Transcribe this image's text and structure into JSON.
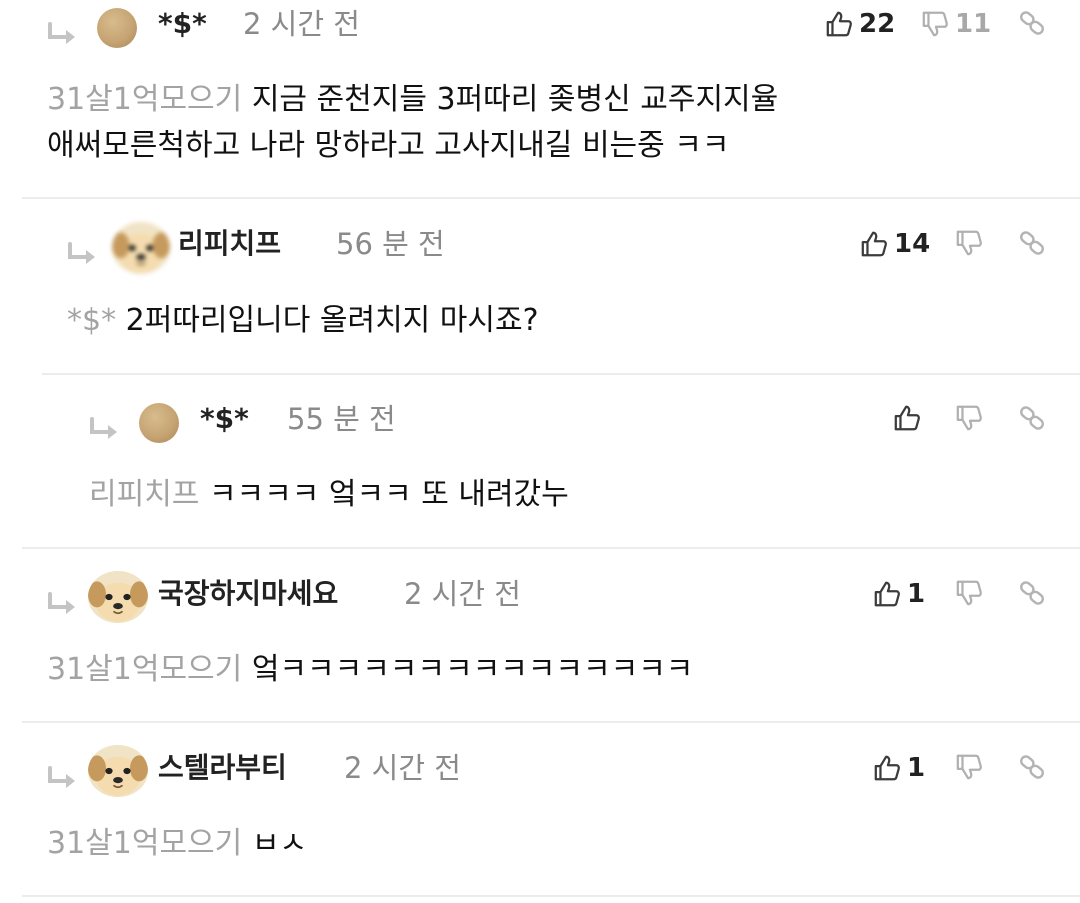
{
  "comments": [
    {
      "author": "*$*",
      "time": "2 시간 전",
      "likes": "22",
      "dislikes": "11",
      "mention": "31살1억모으기",
      "text_line1": "지금 준천지들 3퍼따리 좆병신 교주지지율",
      "text_line2": "애써모른척하고 나라 망하라고 고사지내길 비는중 ㅋㅋ",
      "avatar_icon": "tan-circle-avatar"
    },
    {
      "author": "리피치프",
      "time": "56 분 전",
      "likes": "14",
      "mention": "*$*",
      "text": "2퍼따리입니다 올려치지 마시죠?",
      "avatar_icon": "blurred-puppy-avatar"
    },
    {
      "author": "*$*",
      "time": "55 분 전",
      "mention": "리피치프",
      "text": "ㅋㅋㅋㅋ 엌ㅋㅋ 또 내려갔누",
      "avatar_icon": "tan-circle-avatar"
    },
    {
      "author": "국장하지마세요",
      "time": "2 시간 전",
      "likes": "1",
      "mention": "31살1억모으기",
      "text": "엌ㅋㅋㅋㅋㅋㅋㅋㅋㅋㅋㅋㅋㅋㅋㅋ",
      "avatar_icon": "puppy-avatar"
    },
    {
      "author": "스텔라부티",
      "time": "2 시간 전",
      "likes": "1",
      "mention": "31살1억모으기",
      "text": "ㅂㅅ",
      "avatar_icon": "puppy-avatar"
    }
  ],
  "icons": {
    "reply": "reply-arrow-icon",
    "like": "thumbs-up-icon",
    "dislike": "thumbs-down-icon",
    "link": "link-icon"
  },
  "colors": {
    "meta": "#8a8a8a",
    "mention": "#a3a3a3",
    "icon": "#4a4a4a",
    "icon_muted": "#b4b4b4",
    "divider": "#ececec"
  }
}
